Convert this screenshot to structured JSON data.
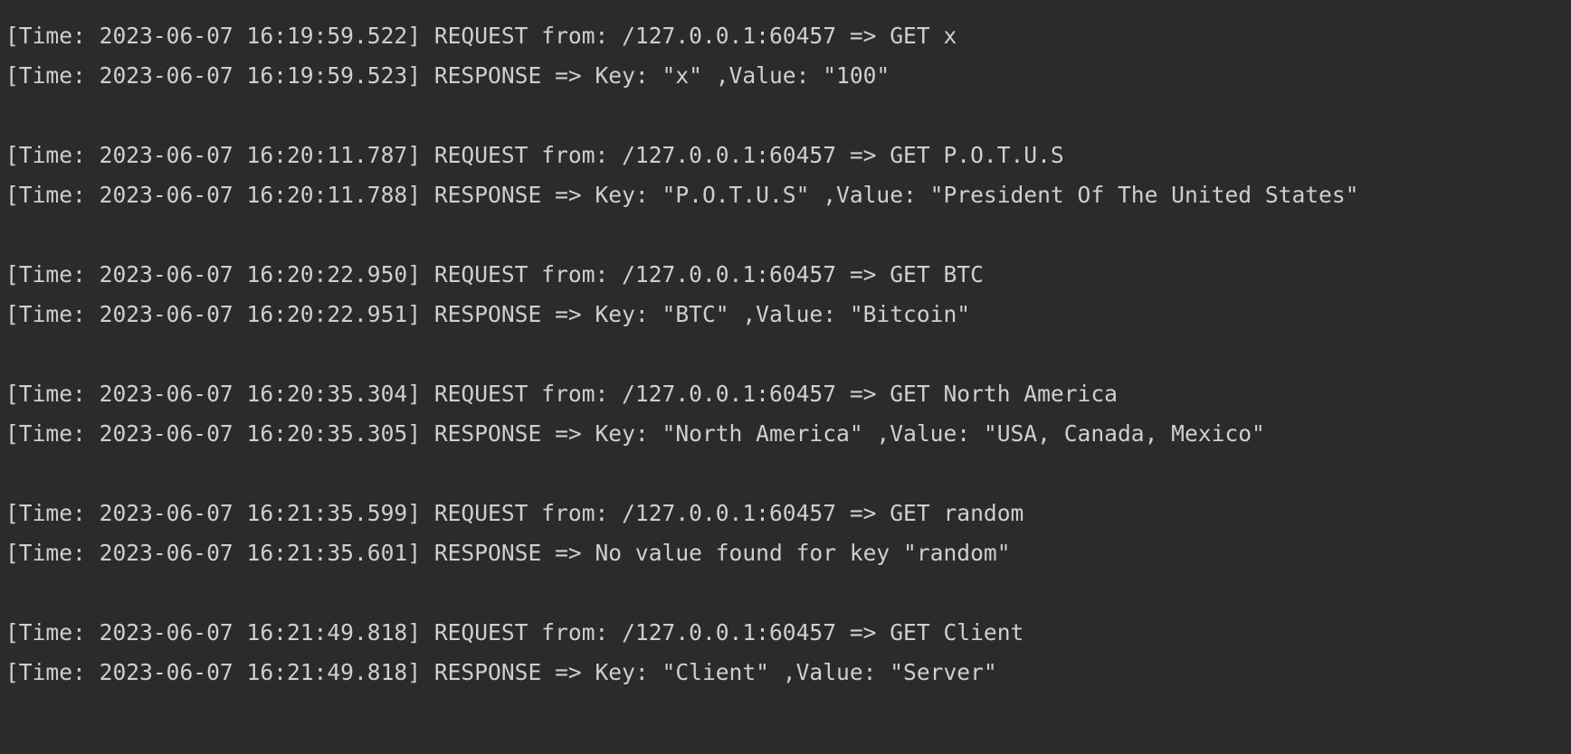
{
  "console": {
    "groups": [
      {
        "request": "[Time: 2023-06-07 16:19:59.522] REQUEST from: /127.0.0.1:60457 => GET x",
        "response": "[Time: 2023-06-07 16:19:59.523] RESPONSE => Key: \"x\" ,Value: \"100\""
      },
      {
        "request": "[Time: 2023-06-07 16:20:11.787] REQUEST from: /127.0.0.1:60457 => GET P.O.T.U.S",
        "response": "[Time: 2023-06-07 16:20:11.788] RESPONSE => Key: \"P.O.T.U.S\" ,Value: \"President Of The United States\""
      },
      {
        "request": "[Time: 2023-06-07 16:20:22.950] REQUEST from: /127.0.0.1:60457 => GET BTC",
        "response": "[Time: 2023-06-07 16:20:22.951] RESPONSE => Key: \"BTC\" ,Value: \"Bitcoin\""
      },
      {
        "request": "[Time: 2023-06-07 16:20:35.304] REQUEST from: /127.0.0.1:60457 => GET North America",
        "response": "[Time: 2023-06-07 16:20:35.305] RESPONSE => Key: \"North America\" ,Value: \"USA, Canada, Mexico\""
      },
      {
        "request": "[Time: 2023-06-07 16:21:35.599] REQUEST from: /127.0.0.1:60457 => GET random",
        "response": "[Time: 2023-06-07 16:21:35.601] RESPONSE => No value found for key \"random\""
      },
      {
        "request": "[Time: 2023-06-07 16:21:49.818] REQUEST from: /127.0.0.1:60457 => GET Client",
        "response": "[Time: 2023-06-07 16:21:49.818] RESPONSE => Key: \"Client\" ,Value: \"Server\""
      }
    ]
  },
  "colors": {
    "background": "#2b2b2b",
    "text": "#cfcfcf"
  }
}
